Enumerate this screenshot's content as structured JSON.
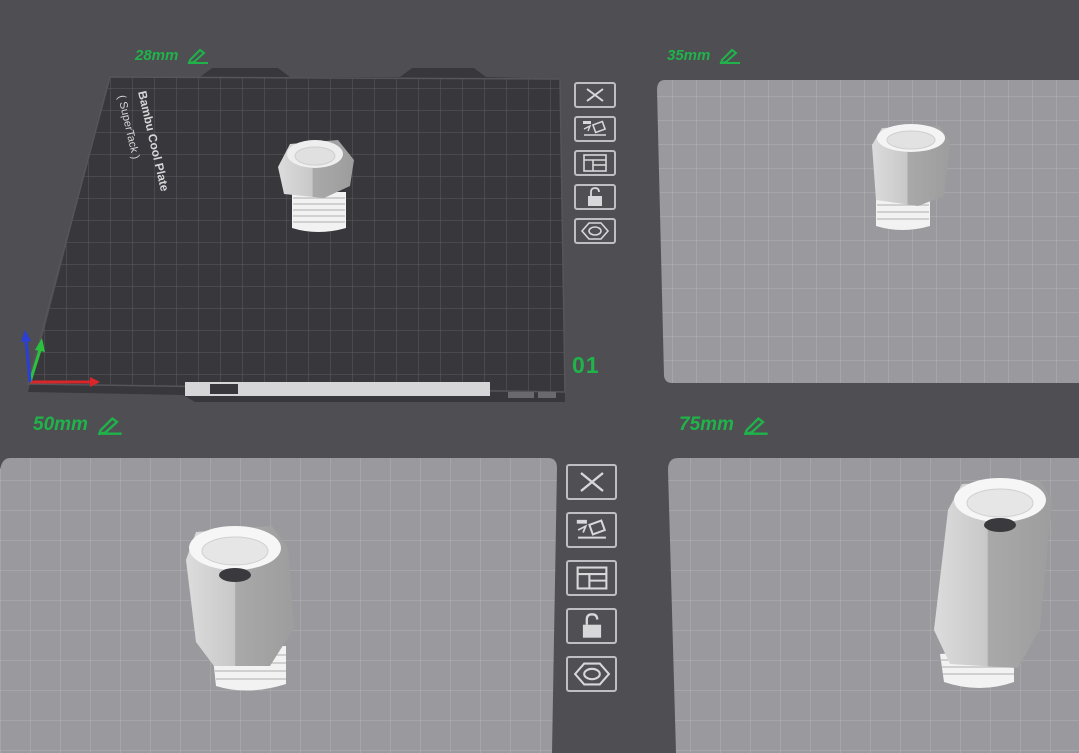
{
  "plates": [
    {
      "id": "plate-1",
      "label": "28mm",
      "active": true
    },
    {
      "id": "plate-2",
      "label": "35mm",
      "active": false
    },
    {
      "id": "plate-3",
      "label": "50mm",
      "active": false
    },
    {
      "id": "plate-4",
      "label": "75mm",
      "active": false
    }
  ],
  "active_plate": {
    "name": "Bambu Cool Plate",
    "subname": "( SuperTack )",
    "number": "01"
  },
  "toolbar_icons": [
    "close-icon",
    "auto-arrange-icon",
    "layout-icon",
    "unlock-icon",
    "plate-settings-icon"
  ],
  "colors": {
    "background": "#4e4e53",
    "label_green": "#1fb34a",
    "active_plate": "#38383c",
    "inactive_plate": "#9a9a9e",
    "axis_x": "#d8262a",
    "axis_y": "#2cc040",
    "axis_z": "#2a3fd6"
  }
}
